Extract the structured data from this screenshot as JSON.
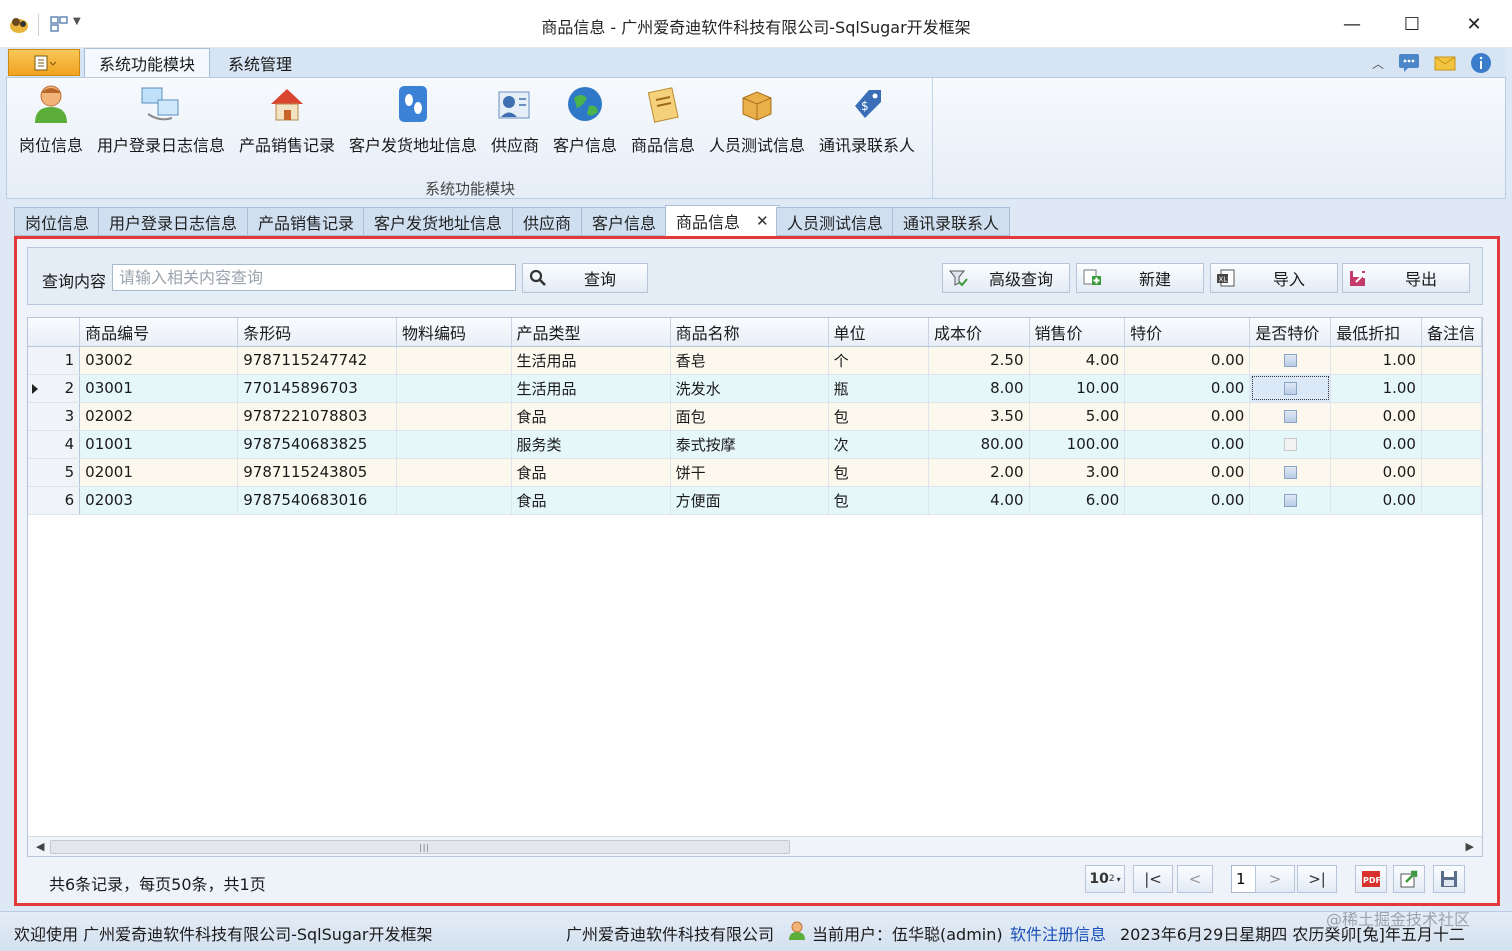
{
  "window": {
    "title": "商品信息 - 广州爱奇迪软件科技有限公司-SqlSugar开发框架",
    "minimize": "—",
    "maximize": "☐",
    "close": "✕"
  },
  "ribbon": {
    "tabs": [
      "系统功能模块",
      "系统管理"
    ],
    "group_label": "系统功能模块",
    "buttons": [
      {
        "label": "岗位信息",
        "icon": "person-icon"
      },
      {
        "label": "用户登录日志信息",
        "icon": "computers-icon"
      },
      {
        "label": "产品销售记录",
        "icon": "house-icon"
      },
      {
        "label": "客户发货地址信息",
        "icon": "footprint-icon"
      },
      {
        "label": "供应商",
        "icon": "supplier-icon"
      },
      {
        "label": "客户信息",
        "icon": "globe-icon"
      },
      {
        "label": "商品信息",
        "icon": "notes-icon"
      },
      {
        "label": "人员测试信息",
        "icon": "boxes-icon"
      },
      {
        "label": "通讯录联系人",
        "icon": "tag-icon"
      }
    ]
  },
  "doc_tabs": [
    "岗位信息",
    "用户登录日志信息",
    "产品销售记录",
    "客户发货地址信息",
    "供应商",
    "客户信息",
    "商品信息",
    "人员测试信息",
    "通讯录联系人"
  ],
  "active_tab_close": "✕",
  "search": {
    "label": "查询内容",
    "placeholder": "请输入相关内容查询",
    "query_button": "查询",
    "advanced_button": "高级查询",
    "new_button": "新建",
    "import_button": "导入",
    "export_button": "导出"
  },
  "grid": {
    "columns": [
      "商品编号",
      "条形码",
      "物料编码",
      "产品类型",
      "商品名称",
      "单位",
      "成本价",
      "销售价",
      "特价",
      "是否特价",
      "最低折扣",
      "备注信"
    ],
    "rows": [
      {
        "no": "1",
        "code": "03002",
        "barcode": "9787115247742",
        "material": "",
        "type": "生活用品",
        "name": "香皂",
        "unit": "个",
        "cost": "2.50",
        "price": "4.00",
        "special": "0.00",
        "is_special": true,
        "discount": "1.00"
      },
      {
        "no": "2",
        "code": "03001",
        "barcode": "770145896703",
        "material": "",
        "type": "生活用品",
        "name": "洗发水",
        "unit": "瓶",
        "cost": "8.00",
        "price": "10.00",
        "special": "0.00",
        "is_special": true,
        "discount": "1.00"
      },
      {
        "no": "3",
        "code": "02002",
        "barcode": "9787221078803",
        "material": "",
        "type": "食品",
        "name": "面包",
        "unit": "包",
        "cost": "3.50",
        "price": "5.00",
        "special": "0.00",
        "is_special": true,
        "discount": "0.00"
      },
      {
        "no": "4",
        "code": "01001",
        "barcode": "9787540683825",
        "material": "",
        "type": "服务类",
        "name": "泰式按摩",
        "unit": "次",
        "cost": "80.00",
        "price": "100.00",
        "special": "0.00",
        "is_special": false,
        "discount": "0.00"
      },
      {
        "no": "5",
        "code": "02001",
        "barcode": "9787115243805",
        "material": "",
        "type": "食品",
        "name": "饼干",
        "unit": "包",
        "cost": "2.00",
        "price": "3.00",
        "special": "0.00",
        "is_special": true,
        "discount": "0.00"
      },
      {
        "no": "6",
        "code": "02003",
        "barcode": "9787540683016",
        "material": "",
        "type": "食品",
        "name": "方便面",
        "unit": "包",
        "cost": "4.00",
        "price": "6.00",
        "special": "0.00",
        "is_special": true,
        "discount": "0.00"
      }
    ],
    "selected_row": 2
  },
  "pager": {
    "info": "共6条记录，每页50条，共1页",
    "first": "|<",
    "prev": "<",
    "page": "1",
    "next": ">",
    "last": ">|",
    "page_size_label": "10"
  },
  "statusbar": {
    "welcome": "欢迎使用 广州爱奇迪软件科技有限公司-SqlSugar开发框架",
    "company": "广州爱奇迪软件科技有限公司",
    "user": "当前用户：伍华聪(admin)",
    "register_link": "软件注册信息",
    "date": "2023年6月29日星期四 农历癸卯[兔]年五月十二",
    "watermark": "@稀土掘金技术社区"
  },
  "colors": {
    "highlight_border": "#e23a3a",
    "ribbon_bg": "#d6e4f4",
    "row_odd": "#fcf8ee",
    "row_even": "#e6f7fa",
    "link": "#1a4fb8"
  }
}
